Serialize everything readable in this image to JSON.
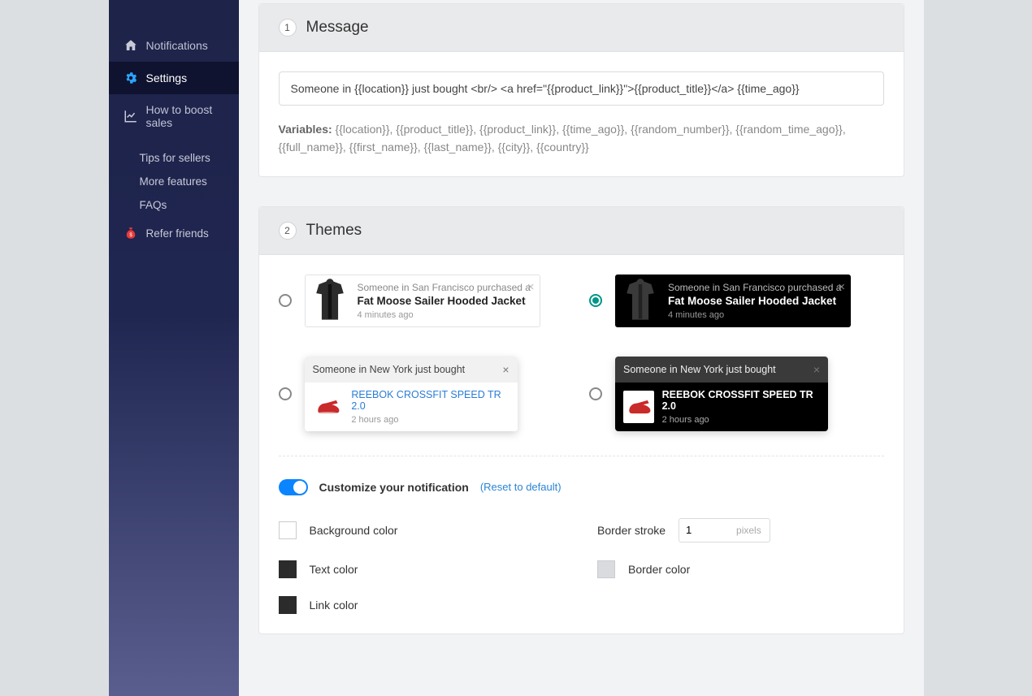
{
  "sidebar": {
    "items": [
      {
        "label": "Notifications"
      },
      {
        "label": "Settings"
      },
      {
        "label": "How to boost sales"
      },
      {
        "label": "Tips for sellers"
      },
      {
        "label": "More features"
      },
      {
        "label": "FAQs"
      },
      {
        "label": "Refer friends"
      }
    ]
  },
  "messagePanel": {
    "step": "1",
    "title": "Message",
    "input": "Someone in {{location}} just bought <br/> <a href=\"{{product_link}}\">{{product_title}}</a> {{time_ago}}",
    "varsLabel": "Variables:",
    "vars": "{{location}}, {{product_title}}, {{product_link}}, {{time_ago}}, {{random_number}}, {{random_time_ago}}, {{full_name}}, {{first_name}}, {{last_name}}, {{city}}, {{country}}"
  },
  "themesPanel": {
    "step": "2",
    "title": "Themes",
    "optA": {
      "top": "Someone in San Francisco purchased a",
      "title": "Fat Moose Sailer Hooded Jacket",
      "time": "4 minutes ago"
    },
    "optB": {
      "bar": "Someone in New York just bought",
      "title": "REEBOK CROSSFIT SPEED TR 2.0",
      "time": "2 hours ago"
    },
    "customize": {
      "label": "Customize your notification",
      "reset": "(Reset to default)"
    },
    "form": {
      "bg": "Background color",
      "text": "Text color",
      "link": "Link color",
      "borderStroke": "Border stroke",
      "borderStrokeVal": "1",
      "borderStrokeUnit": "pixels",
      "borderColor": "Border color"
    }
  }
}
